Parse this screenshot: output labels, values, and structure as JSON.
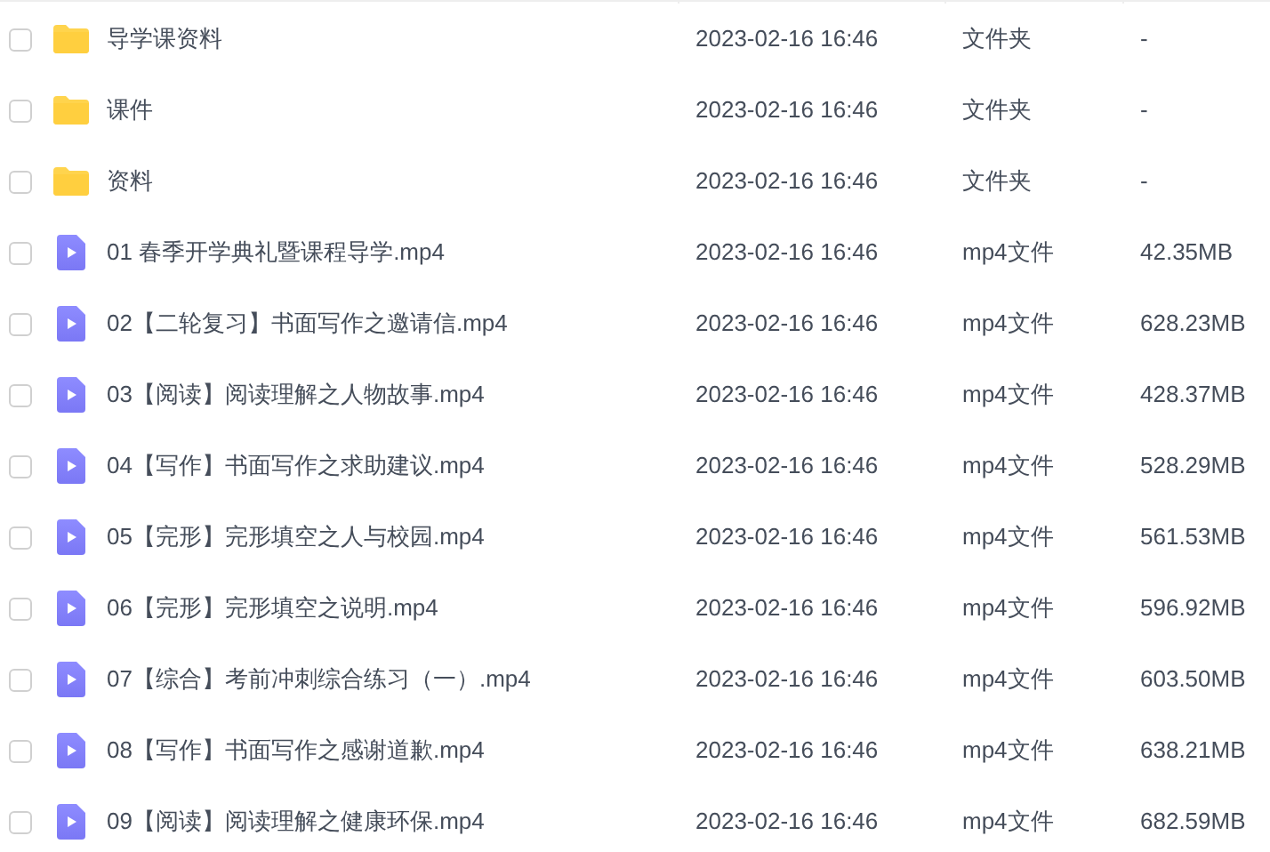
{
  "files": [
    {
      "kind": "folder",
      "checked": false,
      "name": "导学课资料",
      "date": "2023-02-16 16:46",
      "type": "文件夹",
      "size": "-"
    },
    {
      "kind": "folder",
      "checked": false,
      "name": "课件",
      "date": "2023-02-16 16:46",
      "type": "文件夹",
      "size": "-"
    },
    {
      "kind": "folder",
      "checked": false,
      "name": "资料",
      "date": "2023-02-16 16:46",
      "type": "文件夹",
      "size": "-"
    },
    {
      "kind": "video",
      "checked": false,
      "name": "01 春季开学典礼暨课程导学.mp4",
      "date": "2023-02-16 16:46",
      "type": "mp4文件",
      "size": "42.35MB"
    },
    {
      "kind": "video",
      "checked": false,
      "name": "02【二轮复习】书面写作之邀请信.mp4",
      "date": "2023-02-16 16:46",
      "type": "mp4文件",
      "size": "628.23MB"
    },
    {
      "kind": "video",
      "checked": false,
      "name": "03【阅读】阅读理解之人物故事.mp4",
      "date": "2023-02-16 16:46",
      "type": "mp4文件",
      "size": "428.37MB"
    },
    {
      "kind": "video",
      "checked": false,
      "name": "04【写作】书面写作之求助建议.mp4",
      "date": "2023-02-16 16:46",
      "type": "mp4文件",
      "size": "528.29MB"
    },
    {
      "kind": "video",
      "checked": false,
      "name": "05【完形】完形填空之人与校园.mp4",
      "date": "2023-02-16 16:46",
      "type": "mp4文件",
      "size": "561.53MB"
    },
    {
      "kind": "video",
      "checked": false,
      "name": "06【完形】完形填空之说明.mp4",
      "date": "2023-02-16 16:46",
      "type": "mp4文件",
      "size": "596.92MB"
    },
    {
      "kind": "video",
      "checked": false,
      "name": "07【综合】考前冲刺综合练习（一）.mp4",
      "date": "2023-02-16 16:46",
      "type": "mp4文件",
      "size": "603.50MB"
    },
    {
      "kind": "video",
      "checked": false,
      "name": "08【写作】书面写作之感谢道歉.mp4",
      "date": "2023-02-16 16:46",
      "type": "mp4文件",
      "size": "638.21MB"
    },
    {
      "kind": "video",
      "checked": false,
      "name": "09【阅读】阅读理解之健康环保.mp4",
      "date": "2023-02-16 16:46",
      "type": "mp4文件",
      "size": "682.59MB"
    }
  ]
}
